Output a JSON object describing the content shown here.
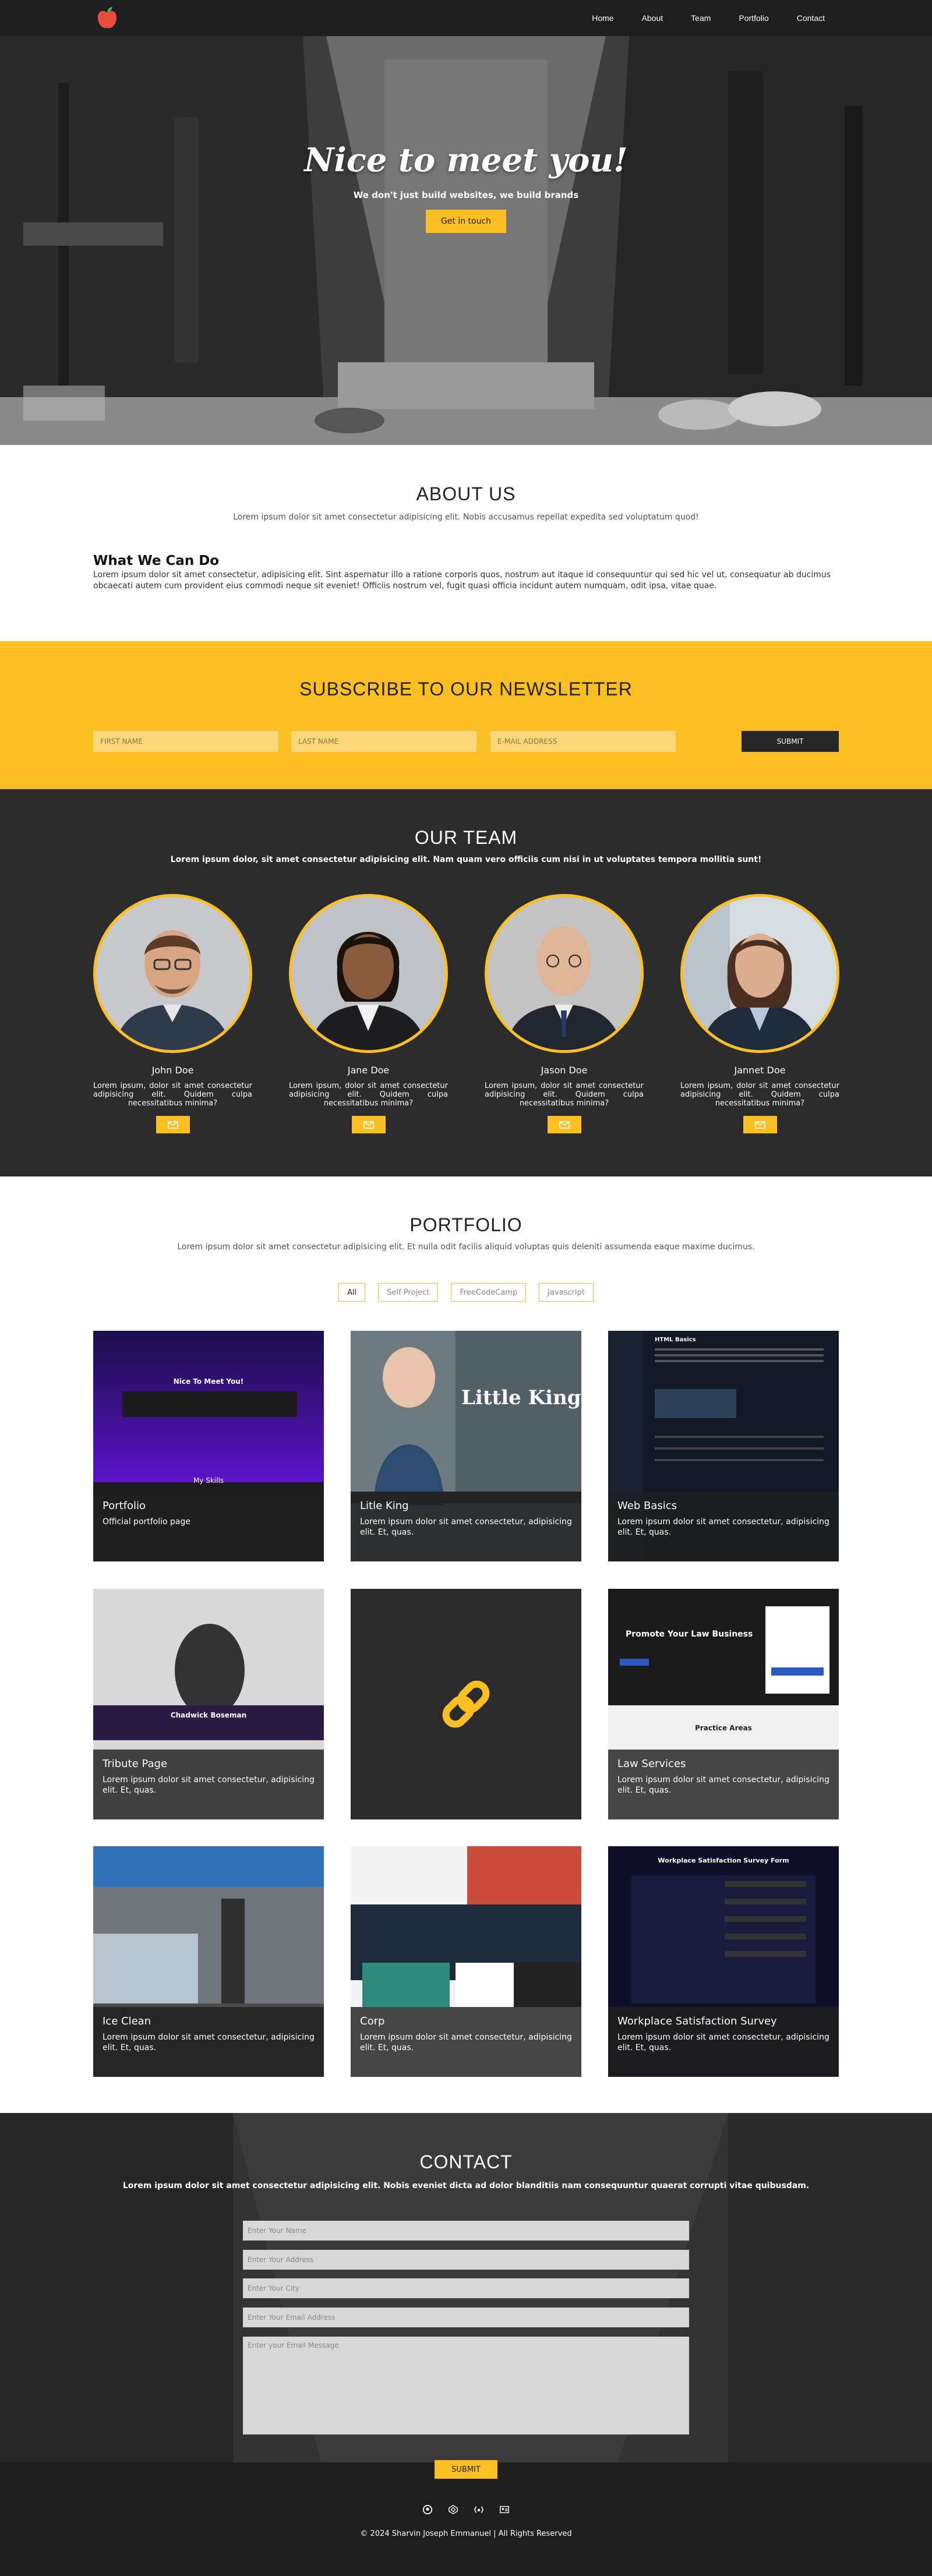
{
  "nav": {
    "logo_icon": "apple-logo-icon",
    "links": [
      "Home",
      "About",
      "Team",
      "Portfolio",
      "Contact"
    ]
  },
  "hero": {
    "title": "Nice to meet you!",
    "subtitle": "We don't just build websites, we build brands",
    "cta": "Get in touch"
  },
  "about": {
    "title": "ABOUT US",
    "text": "Lorem ipsum dolor sit amet consectetur adipisicing elit. Nobis accusamus repellat expedita sed voluptatum quod!",
    "subheading": "What We Can Do",
    "body": "Lorem ipsum dolor sit amet consectetur, adipisicing elit. Sint aspernatur illo a ratione corporis quos, nostrum aut itaque id consequuntur qui sed hic vel ut, consequatur ab ducimus obcaecati autem cum provident eius commodi neque sit eveniet! Officiis nostrum vel, fugit quasi officia incidunt autem numquam, odit ipsa, vitae quae."
  },
  "newsletter": {
    "title": "SUBSCRIBE TO OUR NEWSLETTER",
    "first_name_placeholder": "FIRST NAME",
    "last_name_placeholder": "LAST NAME",
    "email_placeholder": "E-MAIL ADDRESS",
    "submit": "SUBMIT"
  },
  "team": {
    "title": "OUR TEAM",
    "subtitle": "Lorem ipsum dolor, sit amet consectetur adipisicing elit. Nam quam vero officiis cum nisi in ut voluptates tempora mollitia sunt!",
    "members": [
      {
        "name": "John Doe",
        "desc": "Lorem ipsum, dolor sit amet consectetur adipisicing elit. Quidem culpa necessitatibus minima?"
      },
      {
        "name": "Jane Doe",
        "desc": "Lorem ipsum, dolor sit amet consectetur adipisicing elit. Quidem culpa necessitatibus minima?"
      },
      {
        "name": "Jason Doe",
        "desc": "Lorem ipsum, dolor sit amet consectetur adipisicing elit. Quidem culpa necessitatibus minima?"
      },
      {
        "name": "Jannet Doe",
        "desc": "Lorem ipsum, dolor sit amet consectetur adipisicing elit. Quidem culpa necessitatibus minima?"
      }
    ],
    "mail_icon": "envelope-icon"
  },
  "portfolio": {
    "title": "PORTFOLIO",
    "subtitle": "Lorem ipsum dolor sit amet consectetur adipisicing elit. Et nulla odit facilis aliquid voluptas quis deleniti assumenda eaque maxime ducimus.",
    "filters": [
      "All",
      "Self Project",
      "FreeCodeCamp",
      "Javascript"
    ],
    "active_filter": "All",
    "cards": [
      {
        "title": "Portfolio",
        "desc": "Official portfolio page",
        "thumb_title": "Nice To Meet You!",
        "thumb_label": "My Skills"
      },
      {
        "title": "Litle King",
        "desc": "Lorem ipsum dolor sit amet consectetur, adipisicing elit. Et, quas.",
        "thumb_title": "Little King"
      },
      {
        "title": "Web Basics",
        "desc": "Lorem ipsum dolor sit amet consectetur, adipisicing elit. Et, quas.",
        "thumb_title": "HTML Basics"
      },
      {
        "title": "Tribute Page",
        "desc": "Lorem ipsum dolor sit amet consectetur, adipisicing elit. Et, quas.",
        "thumb_title": "Chadwick Boseman"
      },
      {
        "title": "",
        "desc": "",
        "thumb_icon": "chain-link-icon"
      },
      {
        "title": "Law Services",
        "desc": "Lorem ipsum dolor sit amet consectetur, adipisicing elit. Et, quas.",
        "thumb_title": "Promote Your Law Business",
        "thumb_section": "Practice Areas"
      },
      {
        "title": "Ice Clean",
        "desc": "Lorem ipsum dolor sit amet consectetur, adipisicing elit. Et, quas."
      },
      {
        "title": "Corp",
        "desc": "Lorem ipsum dolor sit amet consectetur, adipisicing elit. Et, quas."
      },
      {
        "title": "Workplace Satisfaction Survey",
        "desc": "Lorem ipsum dolor sit amet consectetur, adipisicing elit. Et, quas.",
        "thumb_title": "Workplace Satisfaction Survey Form"
      }
    ]
  },
  "contact": {
    "title": "CONTACT",
    "subtitle": "Lorem ipsum dolor sit amet consectetur adipisicing elit. Nobis eveniet dicta ad dolor blanditiis nam consequuntur quaerat corrupti vitae quibusdam.",
    "name_placeholder": "Enter Your Name",
    "address_placeholder": "Enter Your Address",
    "city_placeholder": "Enter Your City",
    "email_placeholder": "Enter Your Email Address",
    "message_placeholder": "Enter your Email Message",
    "submit": "SUBMIT",
    "social_icons": [
      "github-icon",
      "codepen-icon",
      "freecodecamp-icon",
      "id-card-icon"
    ]
  },
  "footer": {
    "text": "© 2024 Sharvin Joseph Emmanuel | All Rights Reserved"
  },
  "colors": {
    "accent": "#fbbf24",
    "dark": "#2b2b2b",
    "nav": "#1e1e1e"
  }
}
